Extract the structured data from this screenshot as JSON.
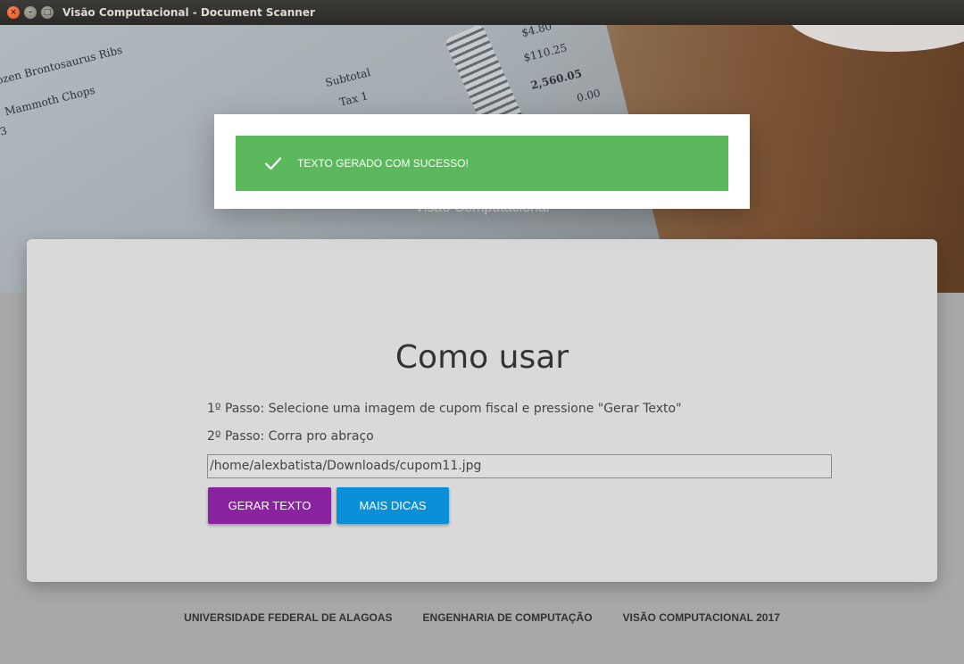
{
  "window": {
    "title": "Visão Computacional - Document Scanner",
    "close_glyph": "×",
    "min_glyph": "–",
    "max_glyph": "□"
  },
  "hero": {
    "subtitle": "Visão Computacional",
    "receipt_lines": [
      "ozen Brontosaurus Ribs",
      "Mammoth Chops",
      "Subtotal",
      "Tax 1",
      "$4.80",
      "$110.25",
      "2,560.05",
      "0.00",
      "3"
    ]
  },
  "notification": {
    "message": "TEXTO GERADO COM SUCESSO!",
    "icon": "check-icon"
  },
  "card": {
    "title": "Como usar",
    "step1": "1º Passo: Selecione uma imagem de cupom fiscal e pressione \"Gerar Texto\"",
    "step2": "2º Passo: Corra pro abraço",
    "file_path": "/home/alexbatista/Downloads/cupom11.jpg",
    "generate_button": "GERAR TEXTO",
    "tips_button": "MAIS DICAS"
  },
  "footer": {
    "links": [
      "UNIVERSIDADE FEDERAL DE ALAGOAS",
      "ENGENHARIA DE COMPUTAÇÃO",
      "VISÃO COMPUTACIONAL 2017"
    ]
  },
  "colors": {
    "success": "#5cb85c",
    "primary_button": "#8a23a0",
    "info_button": "#0b8fd6"
  }
}
